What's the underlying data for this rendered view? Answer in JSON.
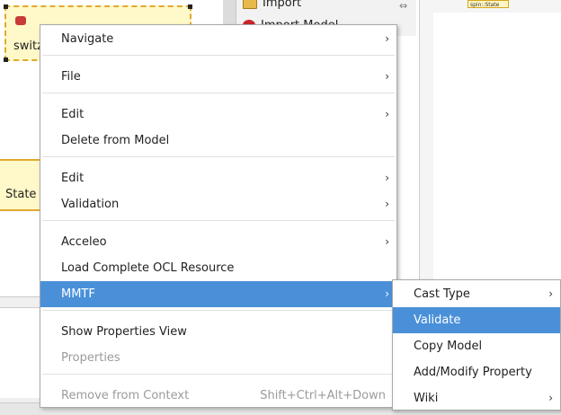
{
  "editor": {
    "state_switch_label": "switz",
    "state_label": "State",
    "mini_state_label": "spin::State"
  },
  "palette": {
    "import_label": "Import",
    "import_model_label": "Import Model"
  },
  "context_menu": {
    "navigate": "Navigate",
    "file": "File",
    "edit_1": "Edit",
    "delete_from_model": "Delete from Model",
    "edit_2": "Edit",
    "validation": "Validation",
    "acceleo": "Acceleo",
    "load_ocl": "Load Complete OCL Resource",
    "mmtf": "MMTF",
    "show_properties_view": "Show Properties View",
    "properties": "Properties",
    "remove_from_context": "Remove from Context",
    "remove_shortcut": "Shift+Ctrl+Alt+Down"
  },
  "mmtf_submenu": {
    "cast_type": "Cast Type",
    "validate": "Validate",
    "copy_model": "Copy Model",
    "add_modify_property": "Add/Modify Property",
    "wiki": "Wiki"
  },
  "icons": {
    "submenu_arrow": "›",
    "pin": "⇔"
  },
  "colors": {
    "highlight": "#4a90d9",
    "state_fill": "#fff8c8",
    "state_border": "#e2a92d",
    "disabled_text": "#9b9b9b"
  }
}
